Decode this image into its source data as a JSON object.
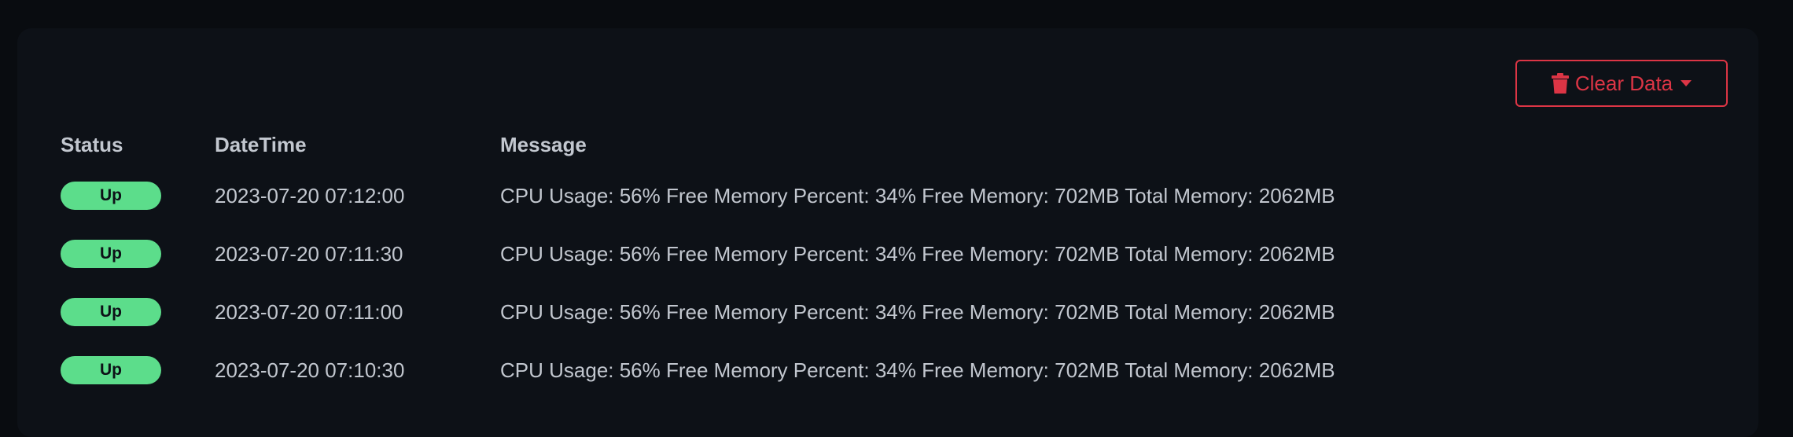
{
  "toolbar": {
    "clear_label": "Clear Data",
    "trash_icon": "trash-icon",
    "caret_icon": "caret-down-icon"
  },
  "colors": {
    "page_bg": "#090c10",
    "panel_bg": "#0d1117",
    "danger": "#dc3545",
    "status_up": "#5cdd8b",
    "text": "#c2c7cf"
  },
  "table": {
    "headers": {
      "status": "Status",
      "datetime": "DateTime",
      "message": "Message"
    },
    "rows": [
      {
        "status": "Up",
        "datetime": "2023-07-20 07:12:00",
        "message": "CPU Usage: 56% Free Memory Percent: 34% Free Memory: 702MB Total Memory: 2062MB"
      },
      {
        "status": "Up",
        "datetime": "2023-07-20 07:11:30",
        "message": "CPU Usage: 56% Free Memory Percent: 34% Free Memory: 702MB Total Memory: 2062MB"
      },
      {
        "status": "Up",
        "datetime": "2023-07-20 07:11:00",
        "message": "CPU Usage: 56% Free Memory Percent: 34% Free Memory: 702MB Total Memory: 2062MB"
      },
      {
        "status": "Up",
        "datetime": "2023-07-20 07:10:30",
        "message": "CPU Usage: 56% Free Memory Percent: 34% Free Memory: 702MB Total Memory: 2062MB"
      }
    ]
  }
}
